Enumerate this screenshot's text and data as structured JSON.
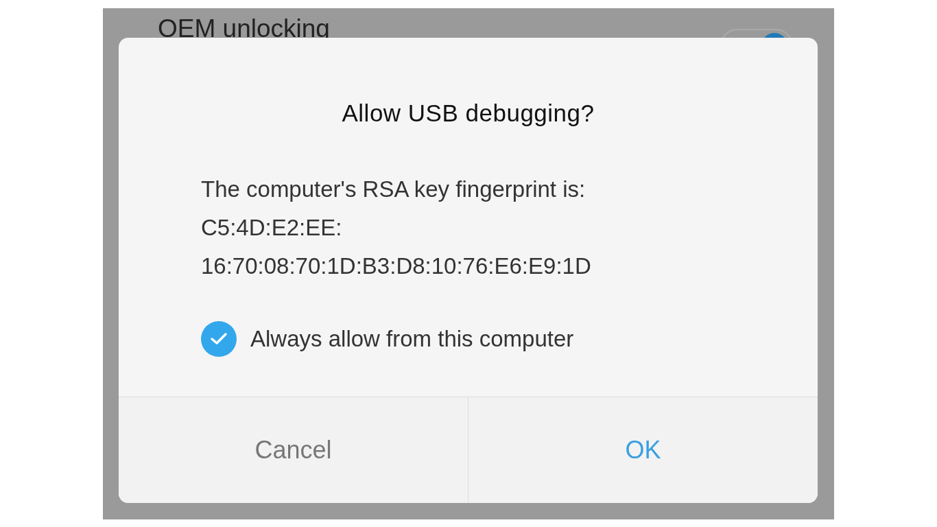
{
  "background_setting": {
    "label": "OEM unlocking",
    "on": true
  },
  "dialog": {
    "title": "Allow USB debugging?",
    "message": [
      "The computer's RSA key fingerprint is:",
      "C5:4D:E2:EE:",
      "16:70:08:70:1D:B3:D8:10:76:E6:E9:1D"
    ],
    "checkbox": {
      "label": "Always allow from this computer",
      "checked": true
    },
    "buttons": [
      {
        "label": "Cancel",
        "kind": "cancel"
      },
      {
        "label": "OK",
        "kind": "confirm"
      }
    ]
  }
}
